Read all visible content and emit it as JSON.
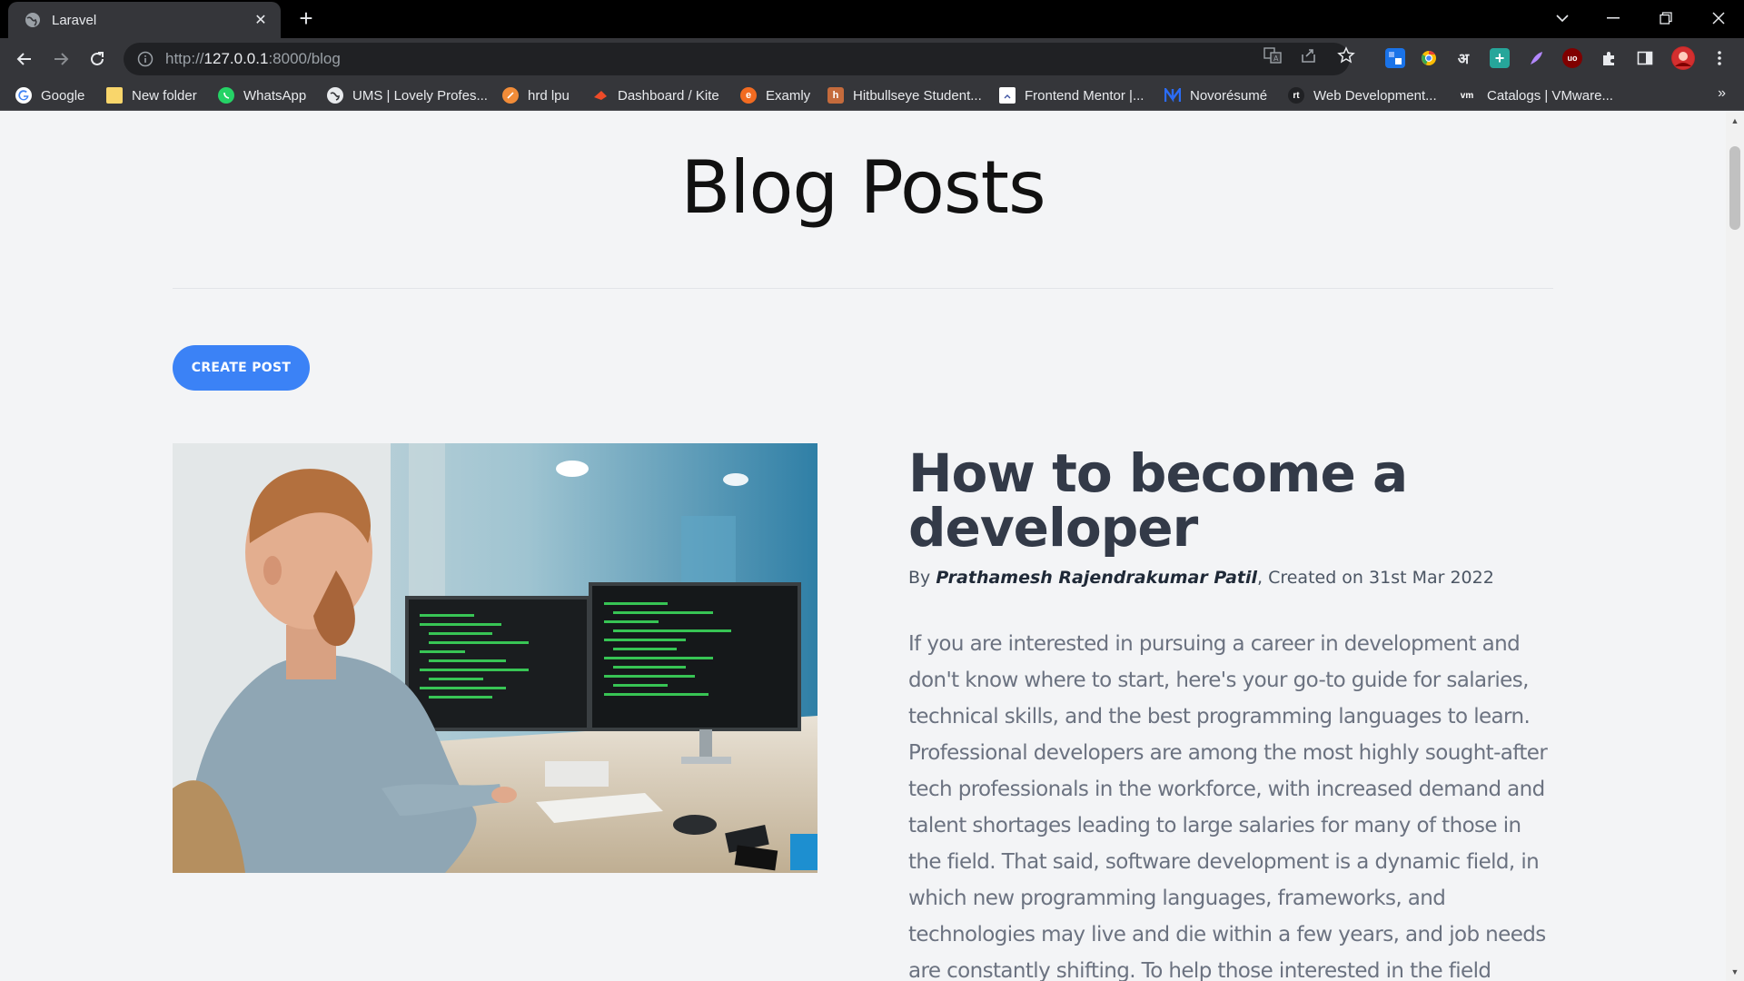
{
  "browser": {
    "tab_title": "Laravel",
    "tab_close": "✕",
    "new_tab": "+",
    "url_prefix": "http://",
    "url_host": "127.0.0.1",
    "url_rest": ":8000/blog",
    "bookmarks": [
      {
        "label": "Google",
        "icon": "google-icon",
        "color": "#ffffff"
      },
      {
        "label": "New folder",
        "icon": "folder-icon",
        "color": "#f9d66b"
      },
      {
        "label": "WhatsApp",
        "icon": "whatsapp-icon",
        "color": "#25d366"
      },
      {
        "label": "UMS | Lovely Profes...",
        "icon": "globe-icon",
        "color": "#e8eaed"
      },
      {
        "label": "hrd lpu",
        "icon": "hrd-icon",
        "color": "#f28c38"
      },
      {
        "label": "Dashboard / Kite",
        "icon": "kite-icon",
        "color": "#ee4b28"
      },
      {
        "label": "Examly",
        "icon": "examly-icon",
        "color": "#f26b21"
      },
      {
        "label": "Hitbullseye Student...",
        "icon": "hitbullseye-icon",
        "color": "#c56b3c"
      },
      {
        "label": "Frontend Mentor |...",
        "icon": "frontend-mentor-icon",
        "color": "#ffffff"
      },
      {
        "label": "Novorésumé",
        "icon": "novoresume-icon",
        "color": "#2b6cf5"
      },
      {
        "label": "Web Development...",
        "icon": "rt-icon",
        "color": "#202124"
      },
      {
        "label": "Catalogs | VMware...",
        "icon": "vmware-icon",
        "color": "#35363a"
      }
    ],
    "more_bookmarks": "»"
  },
  "page": {
    "title": "Blog Posts",
    "create_button": "Create post"
  },
  "post": {
    "title": "How to become a developer",
    "by": "By ",
    "author": "Prathamesh Rajendrakumar Patil",
    "created": ", Created on 31st Mar 2022",
    "body": "If you are interested in pursuing a career in development and don't know where to start, here's your go-to guide for salaries, technical skills, and the best programming languages to learn. Professional developers are among the most highly sought-after tech professionals in the workforce, with increased demand and talent shortages leading to large salaries for many of those in the field. That said, software development is a dynamic field, in which new programming languages, frameworks, and technologies may live and die within a few years, and job needs are constantly shifting. To help those interested in the field better understand how to break",
    "image": "developer-at-monitors-photo"
  },
  "colors": {
    "accent": "#3b82f6",
    "page_bg": "#f3f4f6",
    "title_text": "#333a48",
    "body_text": "#6b7280"
  }
}
